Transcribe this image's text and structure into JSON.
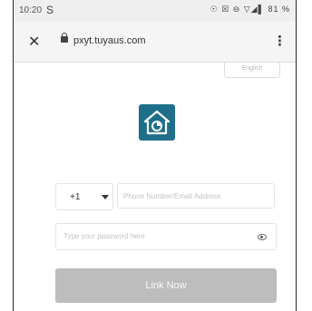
{
  "status_bar": {
    "time": "10:20",
    "s_icon": "S",
    "right_icons": "☉ ☒ ⊖ ▽◢▌ 81 %"
  },
  "browser": {
    "close_icon": "✕",
    "url": "pxyt.tuyaus.com",
    "menu_icon": "⋮"
  },
  "language": {
    "label": "English"
  },
  "login": {
    "country_code": "+1",
    "phone_placeholder": "Phone Number/Email Address",
    "password_placeholder": "Type your password here",
    "submit_label": "Link Now"
  },
  "colors": {
    "logo_bg": "#1f6f8b",
    "button_bg": "#bdbdbd"
  }
}
